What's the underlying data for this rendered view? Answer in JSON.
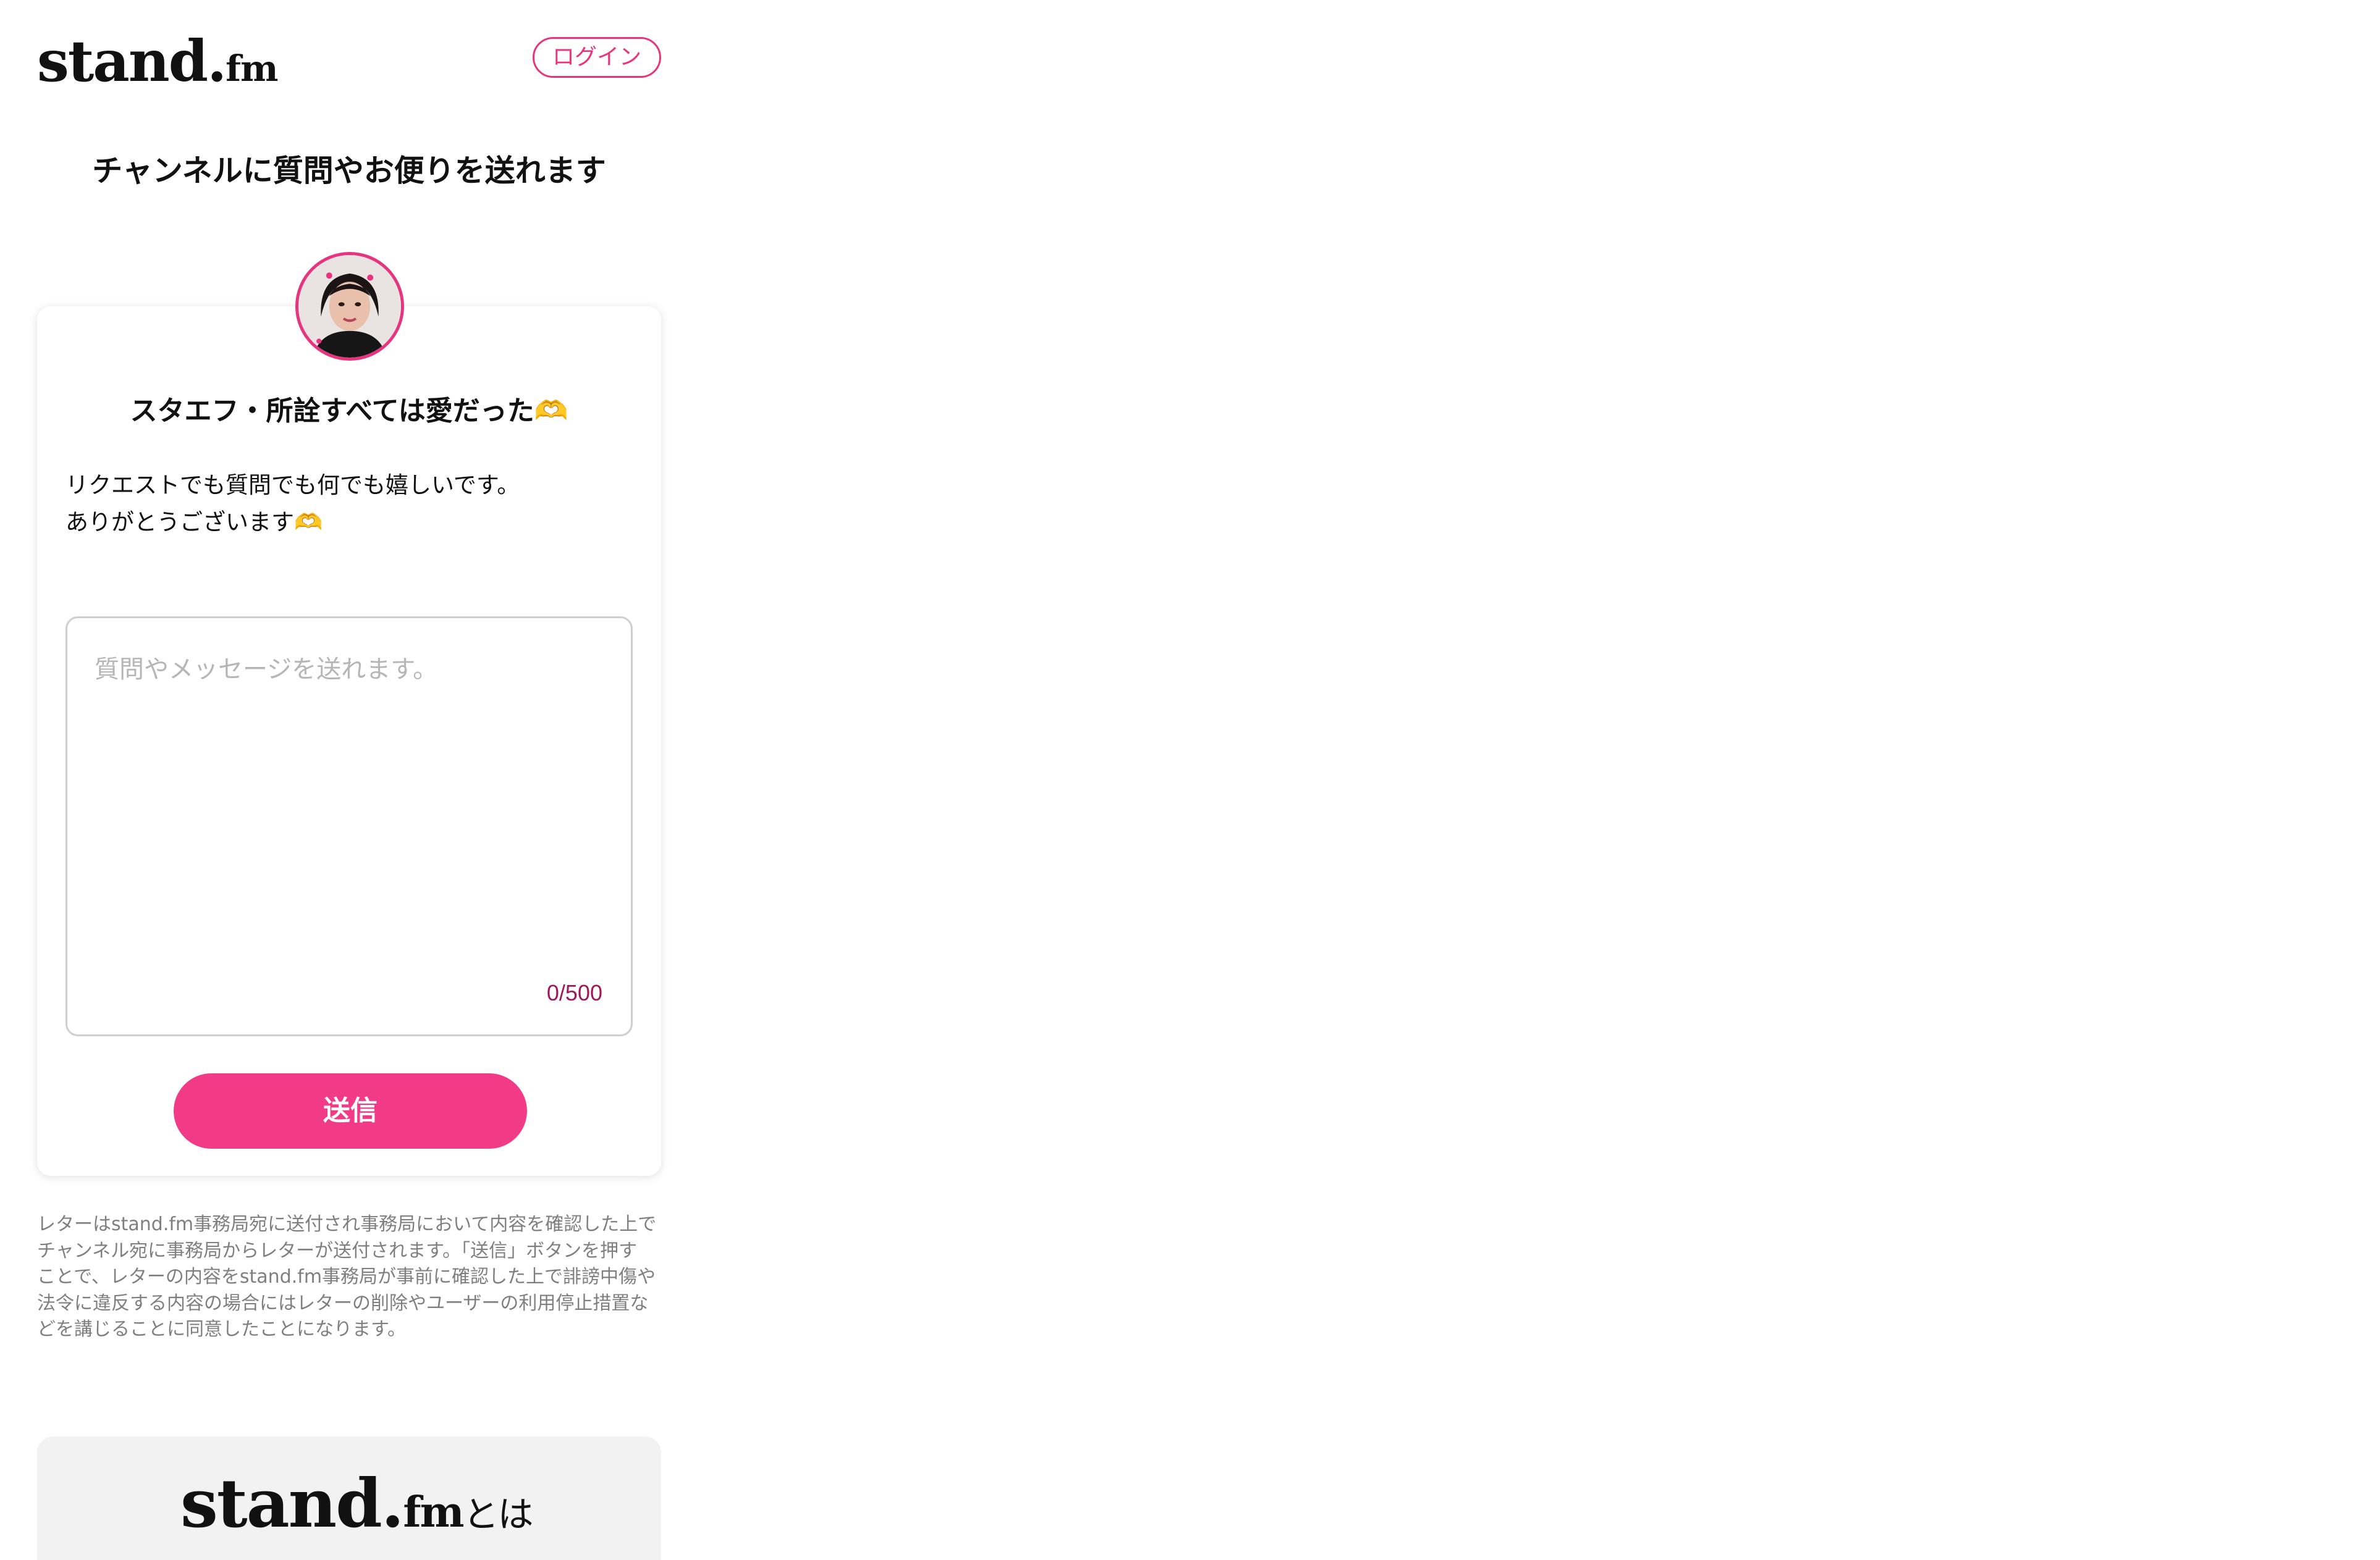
{
  "header": {
    "logo_main": "stand",
    "logo_dot": ".",
    "logo_fm": "fm",
    "login_label": "ログイン"
  },
  "page_title": "チャンネルに質問やお便りを送れます",
  "channel": {
    "name": "スタエフ・所詮すべては愛だった🫶",
    "description_lines": [
      "リクエストでも質問でも何でも嬉しいです。",
      "ありがとうございます🫶"
    ]
  },
  "message_form": {
    "placeholder": "質問やメッセージを送れます。",
    "value": "",
    "counter": "0/500",
    "submit_label": "送信"
  },
  "notice_lines": [
    "レターはstand.fm事務局宛に送付され事務局において内容を確認した上で",
    "チャンネル宛に事務局からレターが送付されます。「送信」ボタンを押す",
    "ことで、レターの内容をstand.fm事務局が事前に確認した上で誹謗中傷や",
    "法令に違反する内容の場合にはレターの削除やユーザーの利用停止措置な",
    "どを講じることに同意したことになります。"
  ],
  "footer": {
    "logo_main": "stand",
    "logo_dot": ".",
    "logo_fm": "fm",
    "logo_tail": "とは"
  },
  "colors": {
    "accent": "#f13b86",
    "login_border": "#e8347f",
    "counter": "#a1185a",
    "notice_text": "#7f7f7f",
    "footer_bg": "#f2f2f2"
  }
}
